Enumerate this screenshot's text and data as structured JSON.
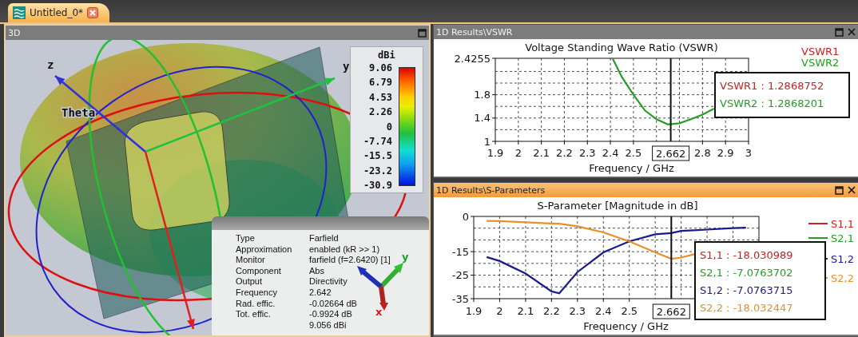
{
  "document_tabs": [
    {
      "label": "Untitled_0*",
      "selected": true
    }
  ],
  "panels": [
    {
      "kind": "view3d",
      "title": "3D",
      "active": false,
      "closable": false,
      "axis_labels": [
        "z",
        "y",
        "Theta"
      ],
      "color_scale": {
        "unit": "dBi",
        "ticks": [
          "9.06",
          "6.79",
          "4.53",
          "2.26",
          "0",
          "-7.74",
          "-15.5",
          "-23.2",
          "-30.9"
        ]
      },
      "info": {
        "rows": [
          {
            "label": "Type",
            "value": "Farfield"
          },
          {
            "label": "Approximation",
            "value": "enabled (kR >> 1)"
          },
          {
            "label": "Monitor",
            "value": "farfield (f=2.6420) [1]"
          },
          {
            "label": "Component",
            "value": "Abs"
          },
          {
            "label": "Output",
            "value": "Directivity"
          },
          {
            "label": "Frequency",
            "value": "2.642"
          },
          {
            "label": "Rad. effic.",
            "value": "-0.02664 dB"
          },
          {
            "label": "Tot. effic.",
            "value": "-0.9924 dB"
          },
          {
            "value": "9.056 dBi"
          }
        ],
        "triad_labels": [
          "y",
          "x"
        ]
      }
    },
    {
      "kind": "chart",
      "title": "1D Results\\VSWR",
      "active": false,
      "closable": true,
      "chart_data": {
        "type": "line",
        "title": "Voltage Standing Wave Ratio (VSWR)",
        "xlabel": "Frequency / GHz",
        "xlim": [
          1.9,
          3
        ],
        "ylim": [
          1,
          2.4255
        ],
        "grid": true,
        "legend": true,
        "ref_lines": [
          {
            "axis": "x",
            "value": 2.662,
            "label": "2.662"
          }
        ],
        "xticks": [
          1.9,
          2,
          2.1,
          2.2,
          2.3,
          2.4,
          2.5,
          2.8,
          2.9,
          3
        ],
        "yticks": [
          1,
          1.4,
          1.8,
          2.4255
        ],
        "x": [
          2.41,
          2.45,
          2.5,
          2.55,
          2.6,
          2.65,
          2.7,
          2.75,
          2.8,
          2.85
        ],
        "series": [
          {
            "name": "VSWR1",
            "color": "#cc2020",
            "values": [
              null,
              null,
              null,
              null,
              null,
              null,
              null,
              null,
              null,
              null
            ]
          },
          {
            "name": "VSWR2",
            "color": "#22a022",
            "values": [
              2.42,
              2.1,
              1.8,
              1.53,
              1.38,
              1.29,
              1.31,
              1.38,
              1.46,
              1.56
            ]
          }
        ]
      },
      "readouts": [
        {
          "text": "VSWR1 : 1.2868752",
          "color": "#cc2020"
        },
        {
          "text": "VSWR2 : 1.2868201",
          "color": "#22a022"
        }
      ]
    },
    {
      "kind": "chart",
      "title": "1D Results\\S-Parameters",
      "active": true,
      "closable": true,
      "chart_data": {
        "type": "line",
        "title": "S-Parameter [Magnitude in dB]",
        "xlabel": "Frequency / GHz",
        "xlim": [
          1.9,
          3
        ],
        "ylim": [
          -35,
          0
        ],
        "grid": true,
        "legend": true,
        "ref_lines": [
          {
            "axis": "x",
            "value": 2.662,
            "label": "2.662"
          }
        ],
        "xticks": [
          1.9,
          2,
          2.1,
          2.2,
          2.3,
          2.4,
          2.5
        ],
        "yticks": [
          0,
          -15,
          -25,
          -35
        ],
        "x": [
          1.95,
          2,
          2.1,
          2.2,
          2.23,
          2.3,
          2.4,
          2.5,
          2.6,
          2.662,
          2.7,
          2.75,
          2.8,
          2.9,
          2.95
        ],
        "series": [
          {
            "name": "S1,1",
            "color": "#cc2020",
            "values": [
              null,
              null,
              null,
              null,
              null,
              null,
              null,
              null,
              null,
              null,
              null,
              null,
              null,
              null,
              null
            ]
          },
          {
            "name": "S2,1",
            "color": "#22a022",
            "values": [
              null,
              null,
              null,
              null,
              null,
              null,
              null,
              null,
              null,
              null,
              null,
              null,
              null,
              null,
              null
            ]
          },
          {
            "name": "S1,2",
            "color": "#1a1a8c",
            "values": [
              -17.3,
              -19,
              -24.3,
              -31.9,
              -32.7,
              -23.7,
              -15.3,
              -10.6,
              -7.6,
              -7.1,
              -6.2,
              -5.9,
              -5.6,
              -5.0,
              -4.8
            ]
          },
          {
            "name": "S2,2",
            "color": "#e8902a",
            "values": [
              -1.9,
              -2,
              -2.5,
              -3,
              -3.1,
              -4.2,
              -6.8,
              -10.6,
              -15.3,
              -18,
              -17.5,
              -16.1,
              null,
              null,
              null
            ]
          }
        ]
      },
      "readouts": [
        {
          "text": "S1,1 : -18.030989",
          "color": "#cc2020"
        },
        {
          "text": "S2,1 : -7.0763702",
          "color": "#22a022"
        },
        {
          "text": "S1,2 : -7.0763715",
          "color": "#1a1a8c"
        },
        {
          "text": "S2,2 : -18.032447",
          "color": "#e8902a"
        }
      ]
    }
  ]
}
